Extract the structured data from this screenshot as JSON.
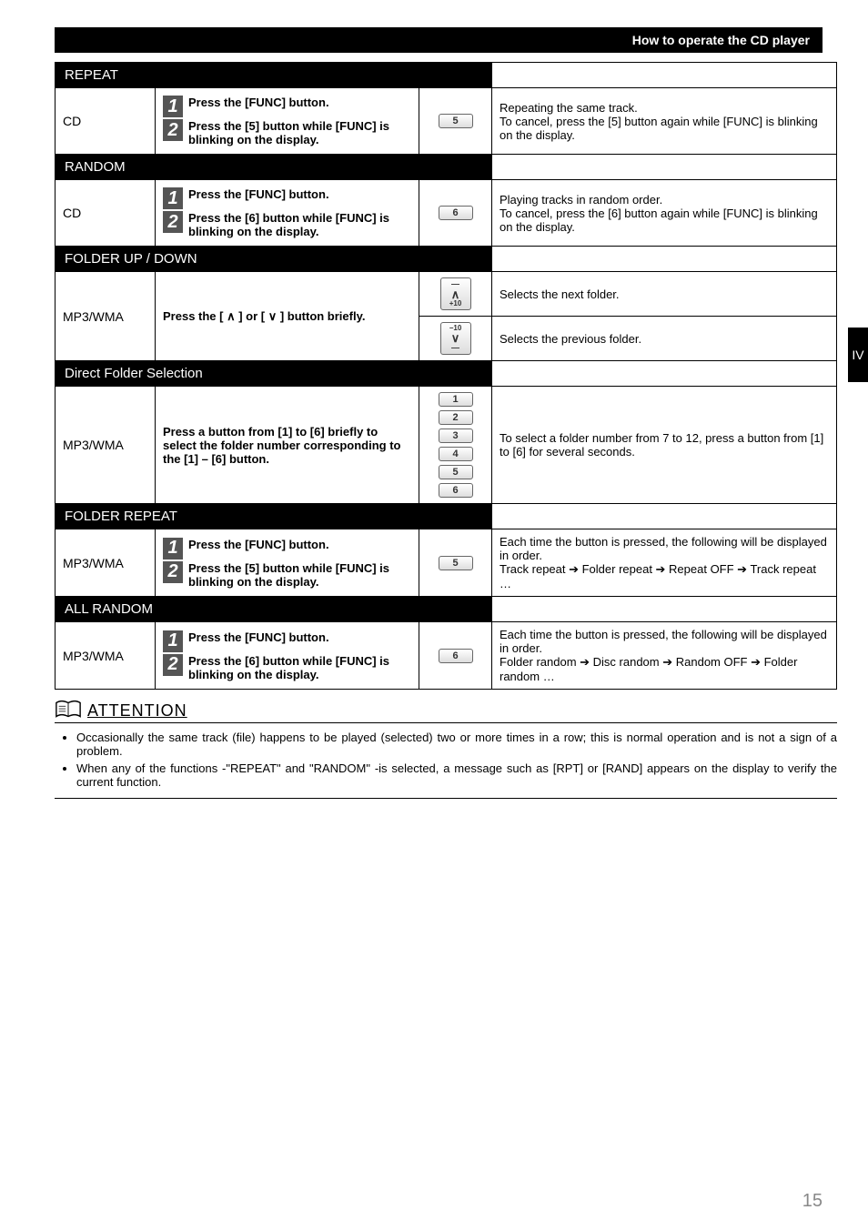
{
  "header": {
    "title": "How to operate the CD player"
  },
  "section_tab": "IV",
  "sections": {
    "repeat": {
      "title": "REPEAT",
      "mode": "CD",
      "step1": "Press the [FUNC] button.",
      "step2": "Press the [5] button while [FUNC] is blinking on the display.",
      "button": "5",
      "desc": "Repeating the same track.\nTo cancel, press the [5] button again while [FUNC] is blinking on the display."
    },
    "random": {
      "title": "RANDOM",
      "mode": "CD",
      "step1": "Press the [FUNC] button.",
      "step2": "Press the [6] button while [FUNC] is blinking on the display.",
      "button": "6",
      "desc": "Playing tracks in random order.\nTo cancel, press the [6] button again while [FUNC] is blinking on the display."
    },
    "folder_updown": {
      "title": "FOLDER UP / DOWN",
      "mode": "MP3/WMA",
      "instr": "Press the [ ∧ ] or [ ∨ ] button briefly.",
      "up_btn_over": "—",
      "up_btn": "∧",
      "up_btn_sub": "+10",
      "down_btn_over": "−10",
      "down_btn": "∨",
      "down_btn_sub": "—",
      "desc_up": "Selects the next folder.",
      "desc_down": "Selects the previous folder."
    },
    "direct_folder": {
      "title": "Direct Folder Selection",
      "mode": "MP3/WMA",
      "instr": "Press a button from [1] to [6] briefly to select the folder number corresponding to the [1] – [6] button.",
      "buttons": [
        "1",
        "2",
        "3",
        "4",
        "5",
        "6"
      ],
      "desc": "To select a folder number from 7 to 12, press a button from [1] to [6] for several seconds."
    },
    "folder_repeat": {
      "title": "FOLDER REPEAT",
      "mode": "MP3/WMA",
      "step1": "Press the [FUNC] button.",
      "step2": "Press the [5] button while [FUNC] is blinking on the display.",
      "button": "5",
      "desc_intro": "Each time the button is pressed, the following will be displayed in order.",
      "desc_seq": "Track repeat ➔ Folder repeat ➔ Repeat OFF ➔ Track repeat …"
    },
    "all_random": {
      "title": "ALL  RANDOM",
      "mode": "MP3/WMA",
      "step1": "Press the [FUNC] button.",
      "step2": "Press the [6] button while [FUNC] is blinking on the display.",
      "button": "6",
      "desc_intro": "Each time the button is pressed, the following will be displayed in order.",
      "desc_seq": "Folder random ➔ Disc random ➔ Random OFF ➔ Folder random …"
    }
  },
  "attention": {
    "title": "ATTENTION",
    "notes": [
      "Occasionally the same track (file) happens to be played (selected) two or more times in a row; this is normal operation and is not a sign of a problem.",
      "When any of the functions -\"REPEAT\" and \"RANDOM\" -is selected, a message such as [RPT] or [RAND] appears on the display to verify the current function."
    ]
  },
  "page_number": "15"
}
